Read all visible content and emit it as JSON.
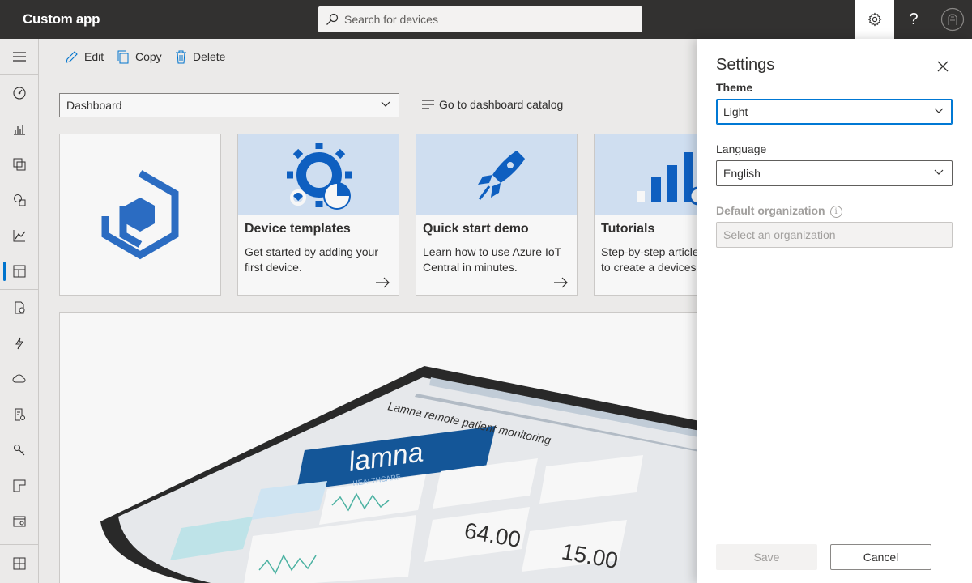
{
  "app": {
    "title": "Custom app"
  },
  "search": {
    "placeholder": "Search for devices"
  },
  "header": {
    "help_label": "?"
  },
  "toolbar": {
    "edit_label": "Edit",
    "copy_label": "Copy",
    "delete_label": "Delete"
  },
  "dashboard": {
    "selected": "Dashboard",
    "catalog_link": "Go to dashboard catalog"
  },
  "tiles": [
    {
      "title": "Device templates",
      "description": "Get started by adding your first device."
    },
    {
      "title": "Quick start demo",
      "description": "Learn how to use Azure IoT Central in minutes."
    },
    {
      "title": "Tutorials",
      "description": "Step-by-step article you how to create a devices."
    }
  ],
  "banner": {
    "heading": "Lamna remote patient monitoring",
    "logo_text": "lamna",
    "logo_sub": "HEALTHCARE",
    "value_1": "64.00",
    "value_2": "15.00"
  },
  "settings": {
    "title": "Settings",
    "theme_label": "Theme",
    "theme_value": "Light",
    "language_label": "Language",
    "language_value": "English",
    "org_label": "Default organization",
    "org_placeholder": "Select an organization",
    "save_label": "Save",
    "cancel_label": "Cancel"
  },
  "colors": {
    "accent": "#0078d4",
    "topbar": "#323130"
  }
}
